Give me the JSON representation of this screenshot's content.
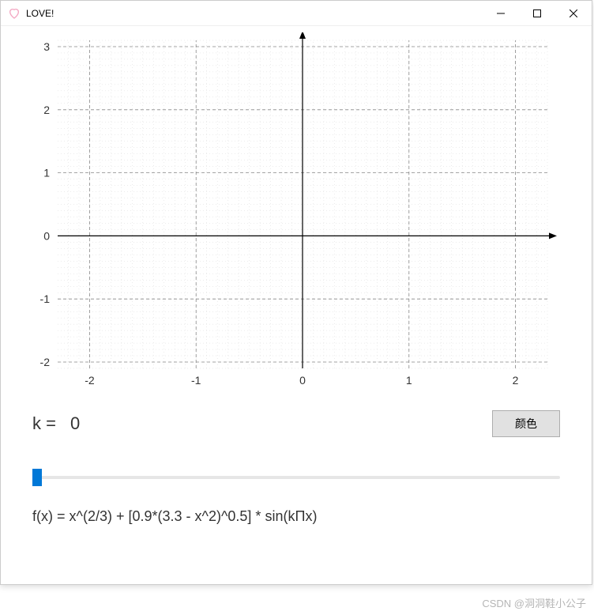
{
  "titlebar": {
    "title": "LOVE!",
    "icon_name": "heart-icon"
  },
  "chart_data": {
    "type": "line",
    "series": [],
    "xlabel": "",
    "ylabel": "",
    "x_ticks": [
      -2,
      -1,
      0,
      1,
      2
    ],
    "y_ticks": [
      -2,
      -1,
      0,
      1,
      2,
      3
    ],
    "xlim": [
      -2.3,
      2.3
    ],
    "ylim": [
      -2.1,
      3.1
    ],
    "grid": true,
    "title": ""
  },
  "controls": {
    "k_label": "k =",
    "k_value": "0",
    "color_button": "颜色",
    "slider_min": 0,
    "slider_max": 100,
    "slider_value": 0
  },
  "formula": "f(x) = x^(2/3) + [0.9*(3.3 - x^2)^0.5] * sin(kΠx)",
  "watermark": "CSDN @洞洞鞋小公子"
}
